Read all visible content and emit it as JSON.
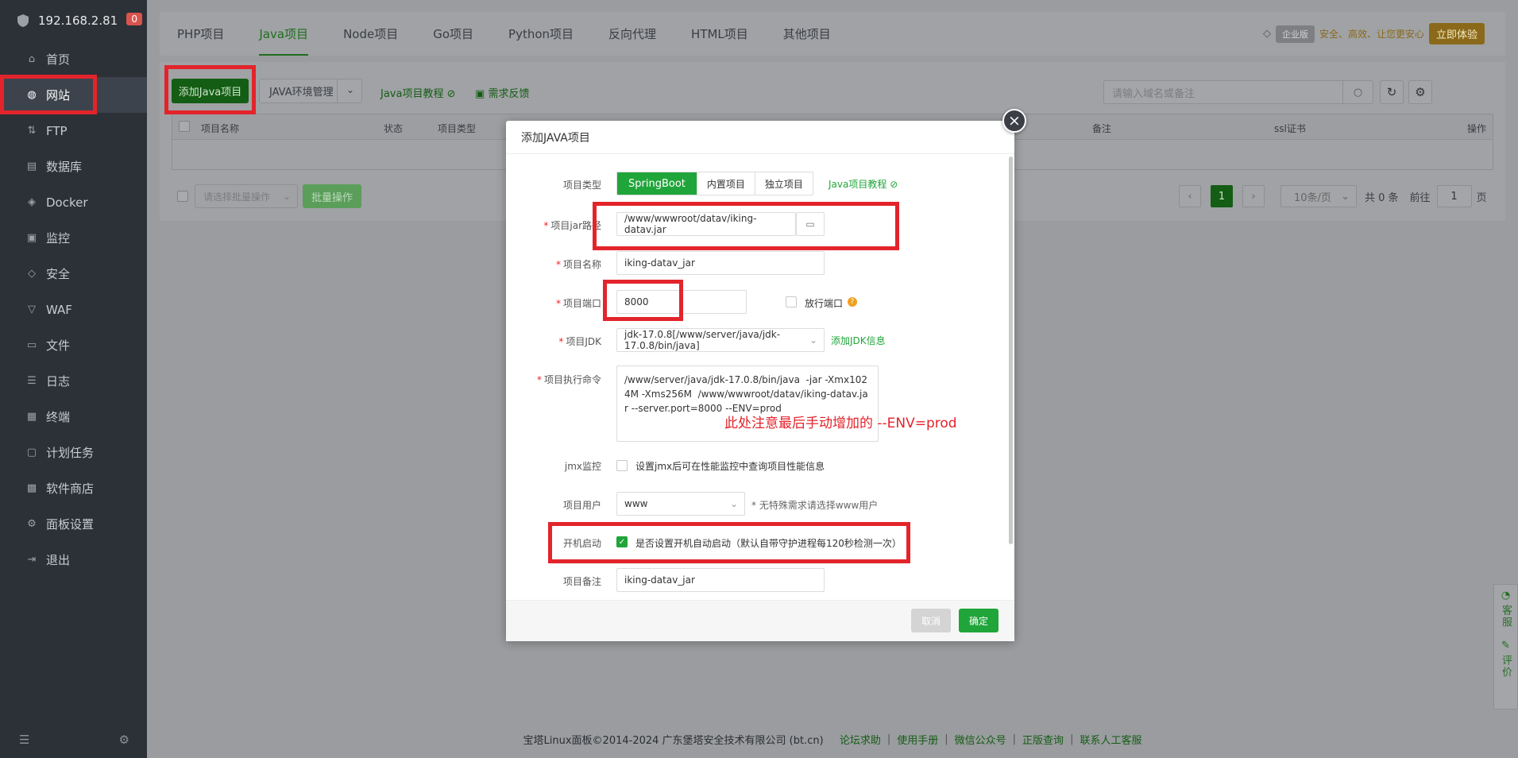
{
  "sidebar": {
    "ip": "192.168.2.81",
    "badge": "0",
    "items": [
      {
        "label": "首页",
        "icon": "home-icon",
        "glyph": "⌂"
      },
      {
        "label": "网站",
        "icon": "globe-icon",
        "glyph": "◍"
      },
      {
        "label": "FTP",
        "icon": "ftp-icon",
        "glyph": "⇅"
      },
      {
        "label": "数据库",
        "icon": "database-icon",
        "glyph": "▤"
      },
      {
        "label": "Docker",
        "icon": "docker-icon",
        "glyph": "◈"
      },
      {
        "label": "监控",
        "icon": "monitor-icon",
        "glyph": "▣"
      },
      {
        "label": "安全",
        "icon": "shield-icon",
        "glyph": "◇"
      },
      {
        "label": "WAF",
        "icon": "waf-icon",
        "glyph": "▽"
      },
      {
        "label": "文件",
        "icon": "folder-icon",
        "glyph": "▭"
      },
      {
        "label": "日志",
        "icon": "log-icon",
        "glyph": "☰"
      },
      {
        "label": "终端",
        "icon": "terminal-icon",
        "glyph": "▦"
      },
      {
        "label": "计划任务",
        "icon": "schedule-icon",
        "glyph": "▢"
      },
      {
        "label": "软件商店",
        "icon": "store-icon",
        "glyph": "▩"
      },
      {
        "label": "面板设置",
        "icon": "settings-icon",
        "glyph": "⚙"
      },
      {
        "label": "退出",
        "icon": "logout-icon",
        "glyph": "⇥"
      }
    ]
  },
  "tabs": [
    "PHP项目",
    "Java项目",
    "Node项目",
    "Go项目",
    "Python项目",
    "反向代理",
    "HTML项目",
    "其他项目"
  ],
  "enterprise": {
    "tag": "企业版",
    "slogan": "安全、高效、让您更安心",
    "button": "立即体验"
  },
  "toolbar": {
    "add_button": "添加Java项目",
    "env_button": "JAVA环境管理",
    "tutorial_link": "Java项目教程",
    "feedback_link": "需求反馈",
    "search_placeholder": "请输入域名或备注"
  },
  "table": {
    "headers": [
      "项目名称",
      "状态",
      "项目类型",
      "备注",
      "ssl证书",
      "操作"
    ]
  },
  "bulk": {
    "select_placeholder": "请选择批量操作",
    "button": "批量操作"
  },
  "pagination": {
    "current": "1",
    "per_page": "10条/页",
    "total": "共 0 条",
    "goto_label": "前往",
    "goto_value": "1",
    "page_unit": "页"
  },
  "footer": {
    "copyright": "宝塔Linux面板©2014-2024 广东堡塔安全技术有限公司 (bt.cn)",
    "links": [
      "论坛求助",
      "使用手册",
      "微信公众号",
      "正版查询",
      "联系人工客服"
    ]
  },
  "side_float": {
    "service": "客服",
    "review": "评价"
  },
  "modal": {
    "title": "添加JAVA项目",
    "type_label": "项目类型",
    "types": [
      "SpringBoot",
      "内置项目",
      "独立项目"
    ],
    "type_link": "Java项目教程",
    "jar_label": "项目jar路径",
    "jar_value": "/www/wwwroot/datav/iking-datav.jar",
    "name_label": "项目名称",
    "name_value": "iking-datav_jar",
    "port_label": "项目端口",
    "port_value": "8000",
    "open_port_label": "放行端口",
    "jdk_label": "项目JDK",
    "jdk_value": "jdk-17.0.8[/www/server/java/jdk-17.0.8/bin/java]",
    "jdk_link": "添加JDK信息",
    "cmd_label": "项目执行命令",
    "cmd_value": "/www/server/java/jdk-17.0.8/bin/java  -jar -Xmx1024M -Xms256M  /www/wwwroot/datav/iking-datav.jar --server.port=8000 --ENV=prod",
    "jmx_label": "jmx监控",
    "jmx_text": "设置jmx后可在性能监控中查询项目性能信息",
    "user_label": "项目用户",
    "user_value": "www",
    "user_hint": "* 无特殊需求请选择www用户",
    "boot_label": "开机启动",
    "boot_text": "是否设置开机自动启动（默认自带守护进程每120秒检测一次）",
    "remark_label": "项目备注",
    "remark_value": "iking-datav_jar",
    "cancel": "取消",
    "ok": "确定"
  },
  "annotation": "此处注意最后手动增加的 --ENV=prod",
  "colors": {
    "accent": "#20a53a",
    "annotation_red": "#e3242b",
    "sidebar_bg": "#2c3138"
  }
}
